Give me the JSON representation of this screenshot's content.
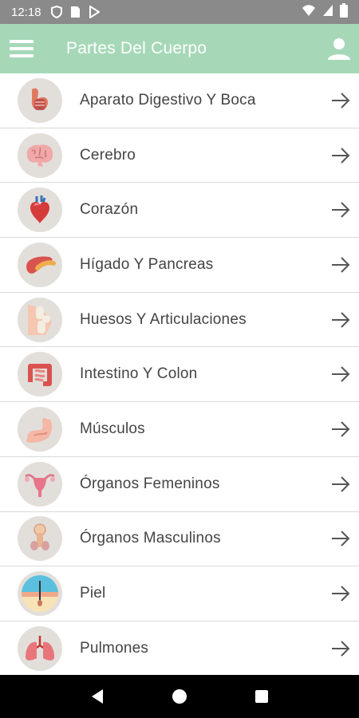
{
  "status_bar": {
    "time": "12:18",
    "icons": [
      "shield-icon",
      "sim-card-icon",
      "play-store-icon",
      "wifi-icon",
      "signal-icon",
      "battery-icon"
    ]
  },
  "app_bar": {
    "title": "Partes Del Cuerpo",
    "background_color": "#a6d8b8",
    "menu_icon": "hamburger-menu-icon",
    "profile_icon": "person-icon"
  },
  "list": {
    "items": [
      {
        "label": "Aparato Digestivo Y Boca",
        "icon": "digestive-system-icon"
      },
      {
        "label": "Cerebro",
        "icon": "brain-icon"
      },
      {
        "label": "Corazón",
        "icon": "heart-icon"
      },
      {
        "label": "Hígado Y Pancreas",
        "icon": "liver-icon"
      },
      {
        "label": "Huesos Y Articulaciones",
        "icon": "knee-joint-icon"
      },
      {
        "label": "Intestino Y Colon",
        "icon": "intestine-icon"
      },
      {
        "label": "Músculos",
        "icon": "muscle-arm-icon"
      },
      {
        "label": "Órganos Femeninos",
        "icon": "uterus-icon"
      },
      {
        "label": "Órganos Masculinos",
        "icon": "male-organ-icon"
      },
      {
        "label": "Piel",
        "icon": "skin-layer-icon"
      },
      {
        "label": "Pulmones",
        "icon": "lungs-icon"
      }
    ],
    "arrow_icon": "arrow-right-icon"
  },
  "nav_bar": {
    "buttons": [
      "back-icon",
      "home-icon",
      "recents-icon"
    ]
  }
}
